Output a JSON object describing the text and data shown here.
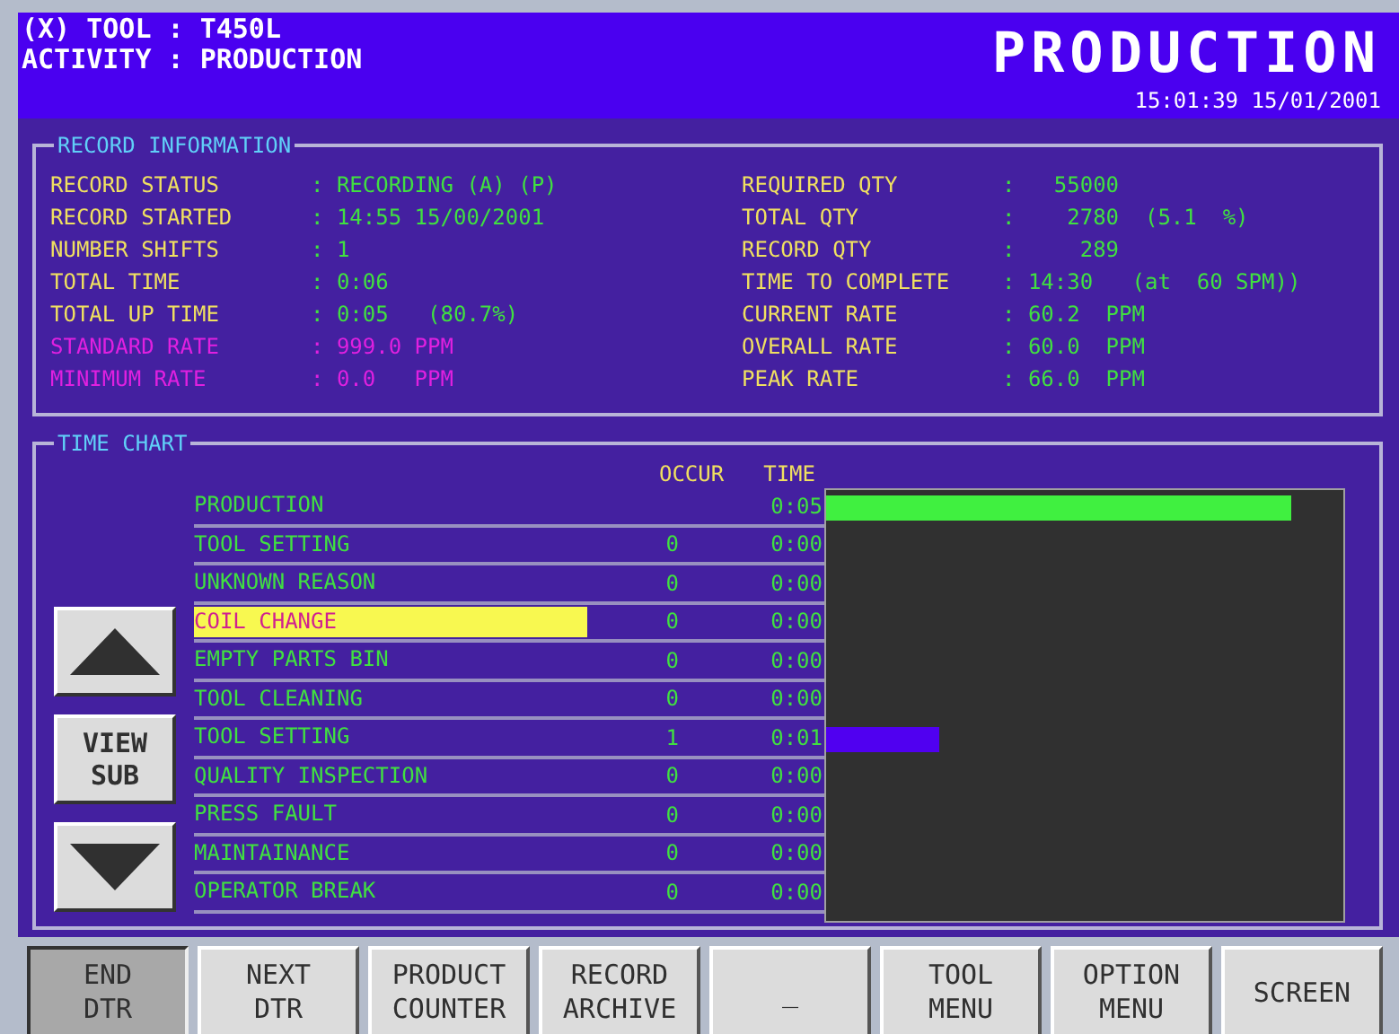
{
  "header": {
    "tool_line": "(X) TOOL : T450L",
    "activity_line": "ACTIVITY : PRODUCTION",
    "screen_title": "PRODUCTION",
    "timestamp": "15:01:39 15/01/2001"
  },
  "record_information": {
    "title": "RECORD INFORMATION",
    "left": [
      {
        "label": "RECORD STATUS",
        "value": ": RECORDING (A) (P)",
        "kind": "normal"
      },
      {
        "label": "RECORD STARTED",
        "value": ": 14:55 15/00/2001",
        "kind": "normal"
      },
      {
        "label": "NUMBER SHIFTS",
        "value": ": 1",
        "kind": "normal"
      },
      {
        "label": "TOTAL TIME",
        "value": ": 0:06",
        "kind": "normal"
      },
      {
        "label": "TOTAL UP TIME",
        "value": ": 0:05   (80.7%)",
        "kind": "normal"
      },
      {
        "label": "STANDARD RATE",
        "value": ": 999.0 PPM",
        "kind": "limit"
      },
      {
        "label": "MINIMUM RATE",
        "value": ": 0.0   PPM",
        "kind": "limit"
      }
    ],
    "right": [
      {
        "label": "REQUIRED QTY",
        "value": ":   55000",
        "kind": "normal"
      },
      {
        "label": "TOTAL QTY",
        "value": ":    2780  (5.1  %)",
        "kind": "normal"
      },
      {
        "label": "RECORD QTY",
        "value": ":     289",
        "kind": "normal"
      },
      {
        "label": "TIME TO COMPLETE",
        "value": ": 14:30   (at  60 SPM))",
        "kind": "normal"
      },
      {
        "label": "CURRENT RATE",
        "value": ": 60.2  PPM",
        "kind": "normal"
      },
      {
        "label": "OVERALL RATE",
        "value": ": 60.0  PPM",
        "kind": "normal"
      },
      {
        "label": "PEAK RATE",
        "value": ": 66.0  PPM",
        "kind": "normal"
      }
    ]
  },
  "time_chart": {
    "title": "TIME CHART",
    "columns": [
      "OCCUR",
      "TIME"
    ],
    "view_sub_button": "VIEW SUB",
    "rows": [
      {
        "reason": "PRODUCTION",
        "time": "0:05",
        "selected": false,
        "level": 0.9,
        "color": "#40f040"
      },
      {
        "reason": "TOOL SETTING",
        "occur": "0",
        "time": "0:00",
        "selected": false
      },
      {
        "reason": "UNKNOWN REASON",
        "occur": "0",
        "time": "0:00",
        "selected": false
      },
      {
        "reason": "COIL CHANGE",
        "occur": "0",
        "time": "0:00",
        "selected": true
      },
      {
        "reason": "EMPTY PARTS BIN",
        "occur": "0",
        "time": "0:00",
        "selected": false
      },
      {
        "reason": "TOOL CLEANING",
        "occur": "0",
        "time": "0:00",
        "selected": false
      },
      {
        "reason": "TOOL SETTING",
        "occur": "1",
        "time": "0:01",
        "selected": false,
        "level": 0.22,
        "color": "#5000f0"
      },
      {
        "reason": "QUALITY INSPECTION",
        "occur": "0",
        "time": "0:00",
        "selected": false
      },
      {
        "reason": "PRESS FAULT",
        "occur": "0",
        "time": "0:00",
        "selected": false
      },
      {
        "reason": "MAINTAINANCE",
        "occur": "0",
        "time": "0:00",
        "selected": false
      },
      {
        "reason": "OPERATOR BREAK",
        "occur": "0",
        "time": "0:00",
        "selected": false
      }
    ]
  },
  "function_keys": [
    {
      "lines": [
        "END",
        "DTR"
      ],
      "pressed": true
    },
    {
      "lines": [
        "NEXT",
        "DTR"
      ],
      "pressed": false
    },
    {
      "lines": [
        "PRODUCT",
        "COUNTER"
      ],
      "pressed": false
    },
    {
      "lines": [
        "RECORD",
        "ARCHIVE"
      ],
      "pressed": false
    },
    {
      "lines": [
        "_"
      ],
      "pressed": false
    },
    {
      "lines": [
        "TOOL",
        "MENU"
      ],
      "pressed": false
    },
    {
      "lines": [
        "OPTION",
        "MENU"
      ],
      "pressed": false
    },
    {
      "lines": [
        "SCREEN"
      ],
      "pressed": false
    }
  ]
}
